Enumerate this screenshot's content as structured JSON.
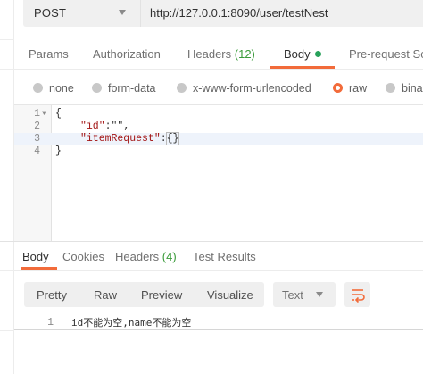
{
  "request": {
    "method": "POST",
    "url": "http://127.0.0.1:8090/user/testNest"
  },
  "request_tabs": {
    "params": "Params",
    "authorization": "Authorization",
    "headers": "Headers",
    "headers_count": "(12)",
    "body": "Body",
    "prerequest": "Pre-request Scr"
  },
  "body_modes": {
    "none": "none",
    "form_data": "form-data",
    "urlencoded": "x-www-form-urlencoded",
    "raw": "raw",
    "binary": "bina",
    "selected": "raw"
  },
  "editor": {
    "lines": [
      {
        "num": "1",
        "brace": "{"
      },
      {
        "num": "2",
        "key": "\"id\"",
        "rest": ":\"\","
      },
      {
        "num": "3",
        "key": "\"itemRequest\"",
        "colon": ":",
        "obj": "{}"
      },
      {
        "num": "4",
        "brace": "}"
      }
    ]
  },
  "response_tabs": {
    "body": "Body",
    "cookies": "Cookies",
    "headers": "Headers",
    "headers_count": "(4)",
    "test_results": "Test Results"
  },
  "response_toolbar": {
    "pretty": "Pretty",
    "raw": "Raw",
    "preview": "Preview",
    "visualize": "Visualize",
    "format": "Text"
  },
  "response_body": {
    "line_num": "1",
    "text": "id不能为空,name不能为空"
  },
  "colors": {
    "accent": "#f26b3a",
    "status_green": "#27a15a",
    "count_green": "#3a9b3a"
  },
  "icons": {
    "method_dropdown": "chevron-down-icon",
    "body_indicator": "dot-icon",
    "fold": "fold-arrow-icon",
    "wrap": "wrap-lines-icon"
  }
}
